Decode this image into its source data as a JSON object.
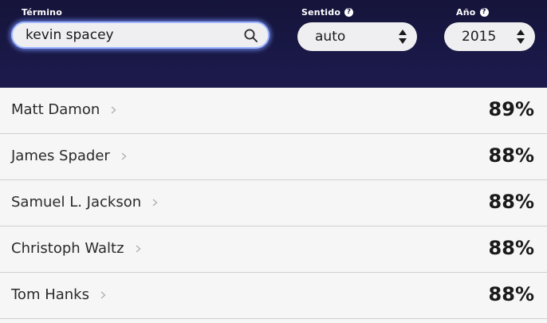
{
  "search": {
    "label": "Término",
    "value": "kevin spacey"
  },
  "direction": {
    "label": "Sentido",
    "value": "auto"
  },
  "year": {
    "label": "Año",
    "value": "2015"
  },
  "results": [
    {
      "name": "Matt Damon",
      "score": "89%"
    },
    {
      "name": "James Spader",
      "score": "88%"
    },
    {
      "name": "Samuel L. Jackson",
      "score": "88%"
    },
    {
      "name": "Christoph Waltz",
      "score": "88%"
    },
    {
      "name": "Tom Hanks",
      "score": "88%"
    }
  ],
  "colors": {
    "header_bg": "#1a1946",
    "focus_glow": "#9fb6ff",
    "row_bg": "#f6f6f6"
  }
}
